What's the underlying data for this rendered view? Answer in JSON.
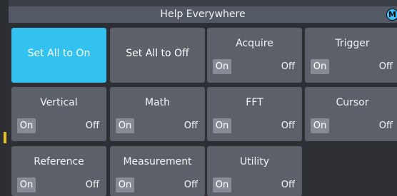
{
  "title": "Help Everywhere",
  "badge": "M",
  "buttons": {
    "set_all_on": "Set All to On",
    "set_all_off": "Set All to Off"
  },
  "toggle_labels": {
    "on": "On",
    "off": "Off"
  },
  "tiles": [
    {
      "name": "Acquire",
      "state": "On"
    },
    {
      "name": "Trigger",
      "state": "On"
    },
    {
      "name": "Vertical",
      "state": "On"
    },
    {
      "name": "Math",
      "state": "On"
    },
    {
      "name": "FFT",
      "state": "On"
    },
    {
      "name": "Cursor",
      "state": "On"
    },
    {
      "name": "Reference",
      "state": "On"
    },
    {
      "name": "Measurement",
      "state": "On"
    },
    {
      "name": "Utility",
      "state": "On"
    }
  ],
  "colors": {
    "active_button": "#33c1ef",
    "tile": "#5c6069",
    "on_chip": "#868b96",
    "badge": "#3dc2ff"
  }
}
